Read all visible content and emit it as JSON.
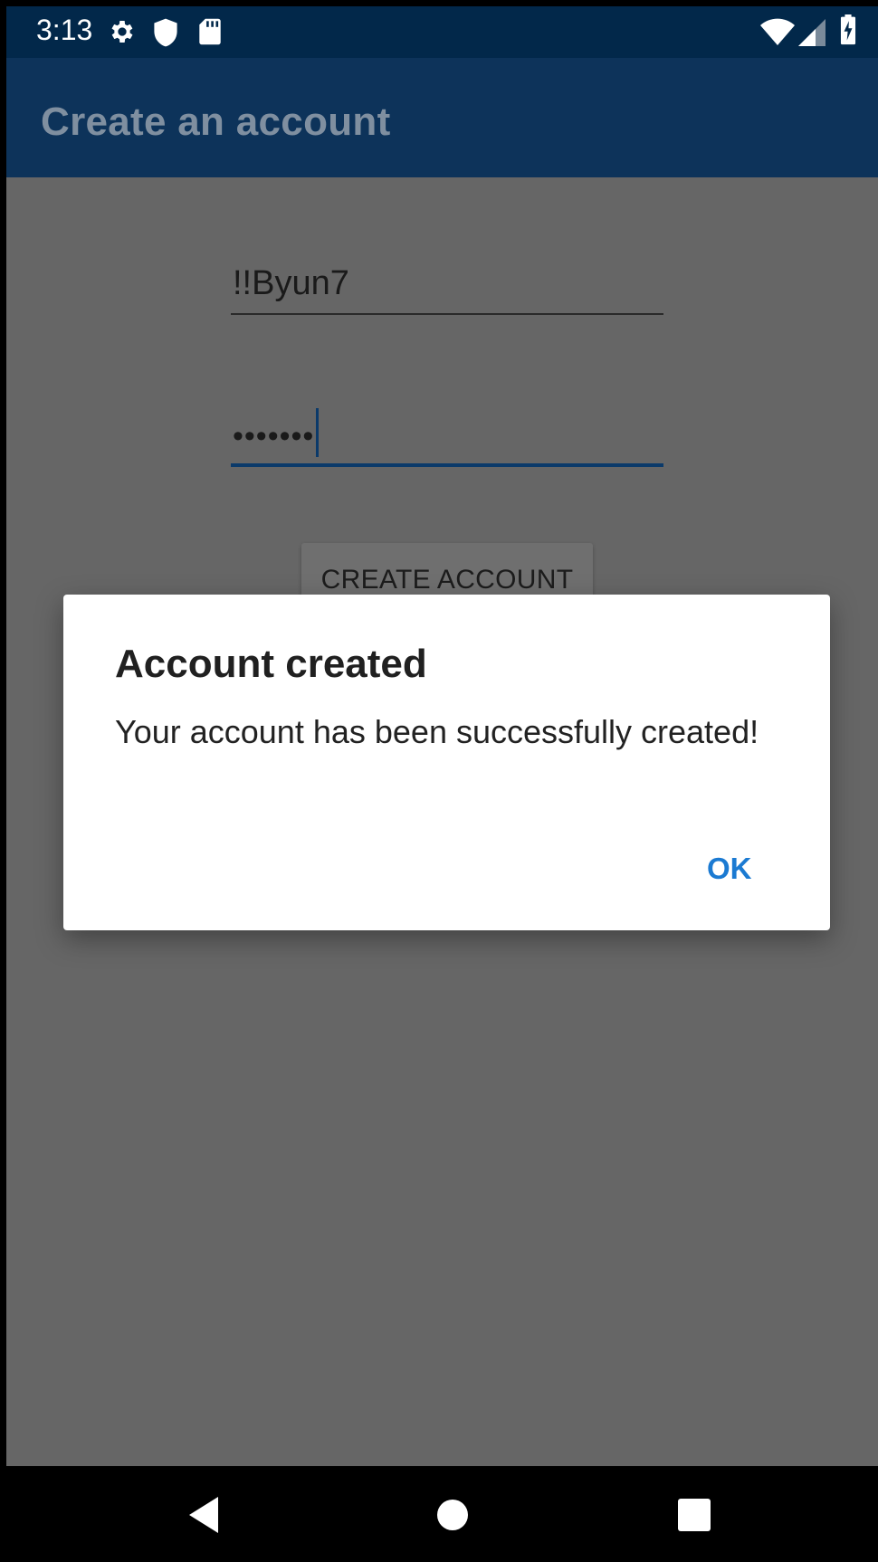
{
  "status_bar": {
    "time": "3:13",
    "icons_left": [
      "gear-icon",
      "shield-icon",
      "sd-card-icon"
    ],
    "icons_right": [
      "wifi-icon",
      "cell-signal-icon",
      "battery-charging-icon"
    ]
  },
  "app_bar": {
    "title": "Create an account"
  },
  "form": {
    "username_value": "!!Byun7",
    "password_masked": "•••••••",
    "create_button_label": "CREATE ACCOUNT"
  },
  "dialog": {
    "title": "Account created",
    "message": "Your account has been successfully created!",
    "ok_label": "OK"
  },
  "nav_bar": {
    "buttons": [
      "back-icon",
      "home-icon",
      "recents-icon"
    ]
  },
  "colors": {
    "status_bar": "#02284a",
    "app_bar": "#0d335a",
    "scrim": "#666666",
    "accent": "#1b7ad2"
  }
}
